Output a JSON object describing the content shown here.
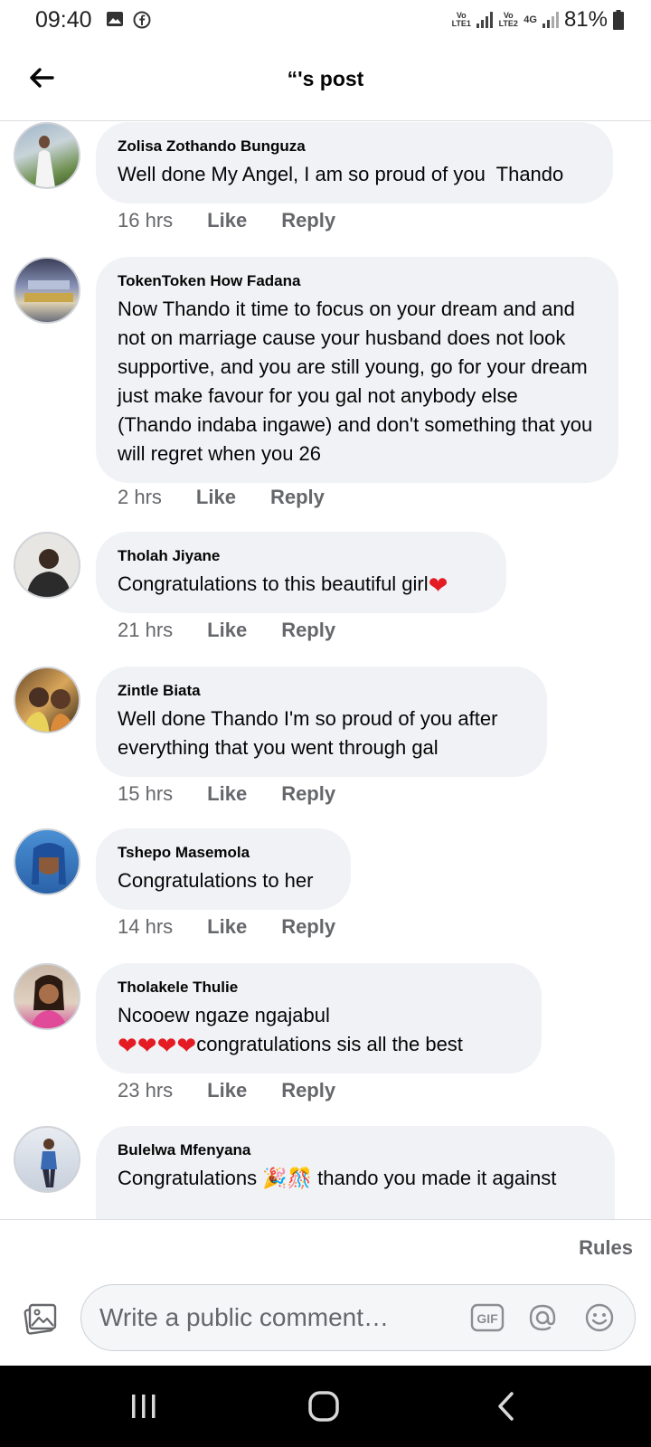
{
  "status_bar": {
    "time": "09:40",
    "battery": "81%",
    "sim1": "Vo LTE1",
    "sim2": "Vo LTE2",
    "network": "4G"
  },
  "header": {
    "title": "“'s post"
  },
  "comments": [
    {
      "author": "Zolisa Zothando Bunguza",
      "text": "Well done My Angel, I am so proud of you  Thando",
      "time": "16 hrs",
      "like": "Like",
      "reply": "Reply"
    },
    {
      "author": "TokenToken How Fadana",
      "text": "Now Thando it time to focus on your dream and and not on marriage cause your husband does not look supportive, and you are still young, go for your dream just make favour for you gal not anybody else (Thando indaba ingawe) and don't something that you will regret when you 26",
      "time": "2 hrs",
      "like": "Like",
      "reply": "Reply"
    },
    {
      "author": "Tholah Jiyane",
      "text": "Congratulations to this beautiful girl",
      "time": "21 hrs",
      "like": "Like",
      "reply": "Reply"
    },
    {
      "author": "Zintle Biata",
      "text": "Well done Thando I'm so proud of you after everything that you went through gal",
      "time": "15 hrs",
      "like": "Like",
      "reply": "Reply"
    },
    {
      "author": "Tshepo Masemola",
      "text": "Congratulations to her",
      "time": "14 hrs",
      "like": "Like",
      "reply": "Reply"
    },
    {
      "author": "Tholakele Thulie",
      "text_line1": "Ncooew ngaze ngajabul",
      "text_line2": "congratulations sis all the best",
      "time": "23 hrs",
      "like": "Like",
      "reply": "Reply"
    },
    {
      "author": "Bulelwa Mfenyana",
      "text_before": "Congratulations ",
      "text_after": " thando you made it against"
    }
  ],
  "rules": "Rules",
  "composer": {
    "placeholder": "Write a public comment…",
    "gif_label": "GIF"
  }
}
